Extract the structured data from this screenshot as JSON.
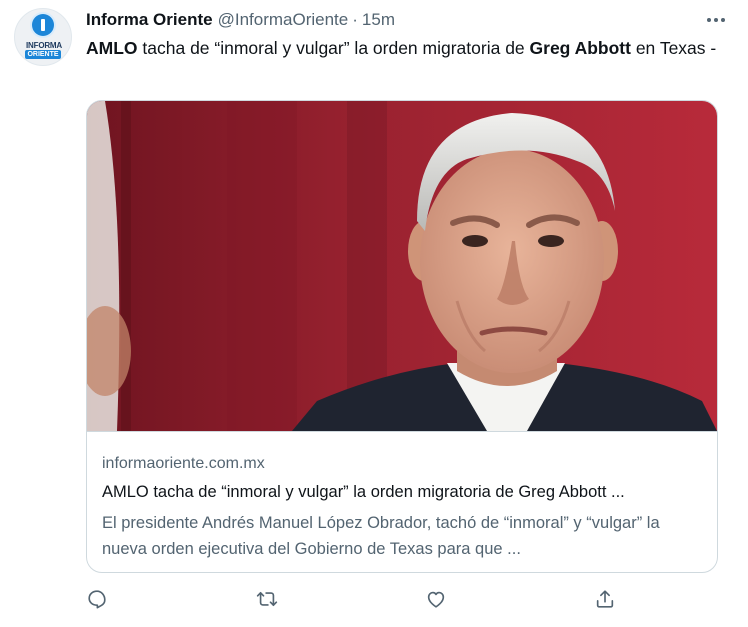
{
  "author": {
    "name": "Informa Oriente",
    "handle": "@InformaOriente",
    "separator": "·",
    "time": "15m",
    "avatar_text_top": "INFORMA",
    "avatar_text_bottom": "ORIENTE"
  },
  "tweet": {
    "text_parts": [
      {
        "text": "AMLO",
        "bold": true
      },
      {
        "text": " tacha de “inmoral y vulgar” la orden migratoria de ",
        "bold": false
      },
      {
        "text": "Greg Abbott",
        "bold": true
      },
      {
        "text": " en Texas -",
        "bold": false
      }
    ]
  },
  "card": {
    "domain": "informaoriente.com.mx",
    "title": "AMLO tacha de “inmoral y vulgar” la orden migratoria de Greg Abbott ...",
    "description": "El presidente Andrés Manuel López Obrador, tachó de “inmoral” y “vulgar” la nueva orden ejecutiva del Gobierno de Texas para que ..."
  },
  "actions": [
    {
      "icon": "reply-icon"
    },
    {
      "icon": "retweet-icon"
    },
    {
      "icon": "like-icon"
    },
    {
      "icon": "share-icon"
    }
  ],
  "colors": {
    "text_primary": "#0f1419",
    "text_secondary": "#536471",
    "border": "#cfd9de",
    "brand_blue": "#1c86d8",
    "photo_background_red": "#8e1d2b"
  }
}
